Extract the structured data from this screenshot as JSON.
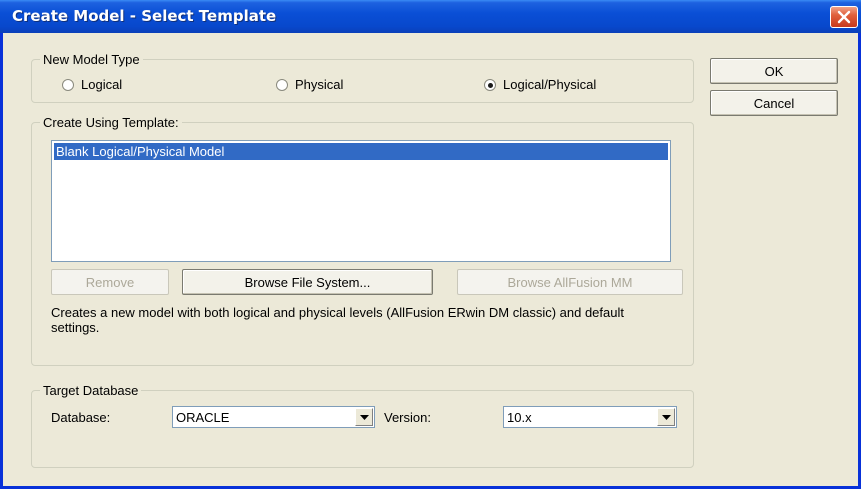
{
  "window": {
    "title": "Create Model - Select Template"
  },
  "new_model_type": {
    "legend": "New Model Type",
    "options": [
      {
        "label": "Logical",
        "checked": false
      },
      {
        "label": "Physical",
        "checked": false
      },
      {
        "label": "Logical/Physical",
        "checked": true
      }
    ]
  },
  "dialog_buttons": {
    "ok": "OK",
    "cancel": "Cancel"
  },
  "template": {
    "legend": "Create Using Template:",
    "items": [
      "Blank Logical/Physical Model"
    ],
    "remove_label": "Remove",
    "browse_fs_label": "Browse File System...",
    "browse_mm_label": "Browse AllFusion MM",
    "description": "Creates a new model with both logical and physical levels (AllFusion ERwin DM classic) and default settings."
  },
  "target": {
    "legend": "Target Database",
    "database_label": "Database:",
    "database_value": "ORACLE",
    "version_label": "Version:",
    "version_value": "10.x"
  },
  "icons": {
    "close": "close-icon",
    "dropdown": "chevron-down-icon"
  },
  "colors": {
    "title_bar": "#0a4fd6",
    "dialog_bg": "#ece9d8",
    "selection": "#316ac5",
    "close_button": "#e0603c"
  }
}
